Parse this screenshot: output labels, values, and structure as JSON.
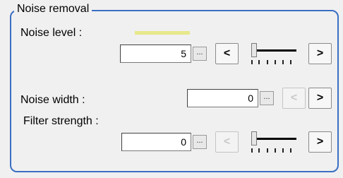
{
  "group": {
    "title": "Noise removal"
  },
  "noise_level": {
    "label": "Noise level :",
    "value": "5",
    "ellipsis": "...",
    "dec": "<",
    "inc": ">"
  },
  "noise_width": {
    "label": "Noise width :",
    "value": "0",
    "ellipsis": "...",
    "dec": "<",
    "inc": ">"
  },
  "filter_strength": {
    "label": "Filter strength :",
    "value": "0",
    "ellipsis": "...",
    "dec": "<",
    "inc": ">"
  }
}
